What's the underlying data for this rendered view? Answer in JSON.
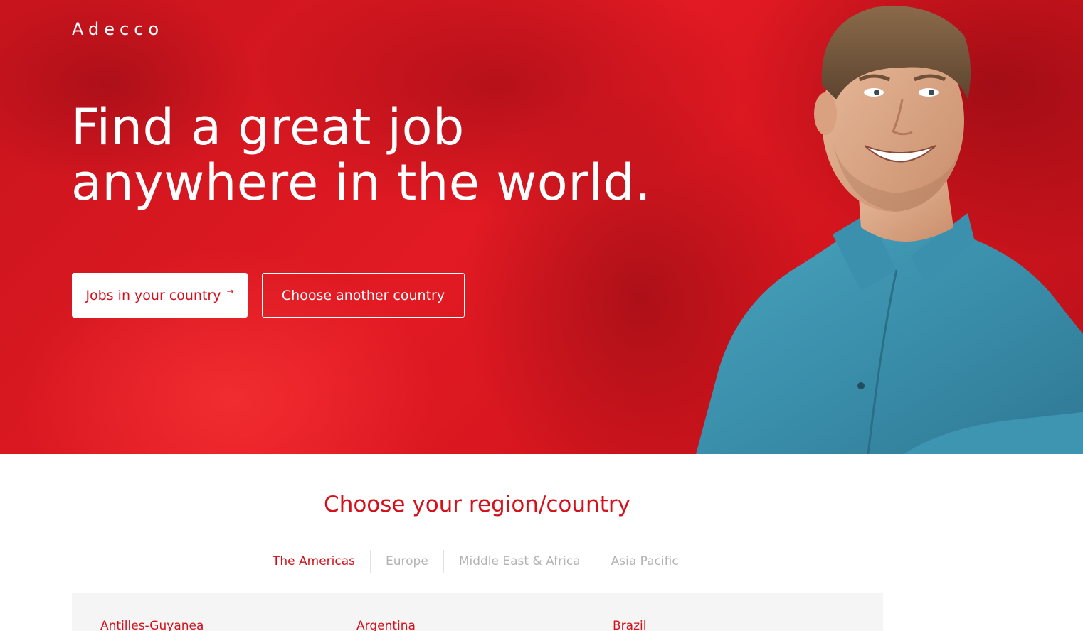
{
  "brand": {
    "logo_text": "Adecco",
    "accent_color": "#d4111b"
  },
  "hero": {
    "headline": "Find a great job anywhere in the world.",
    "primary_button": "Jobs in your country",
    "primary_button_icon": "arrow-right-icon",
    "secondary_button": "Choose another country"
  },
  "region_section": {
    "title": "Choose your region/country",
    "tabs": [
      {
        "label": "The Americas",
        "active": true
      },
      {
        "label": "Europe",
        "active": false
      },
      {
        "label": "Middle East & Africa",
        "active": false
      },
      {
        "label": "Asia Pacific",
        "active": false
      }
    ],
    "countries": [
      "Antilles-Guyanea",
      "Argentina",
      "Brazil"
    ]
  }
}
